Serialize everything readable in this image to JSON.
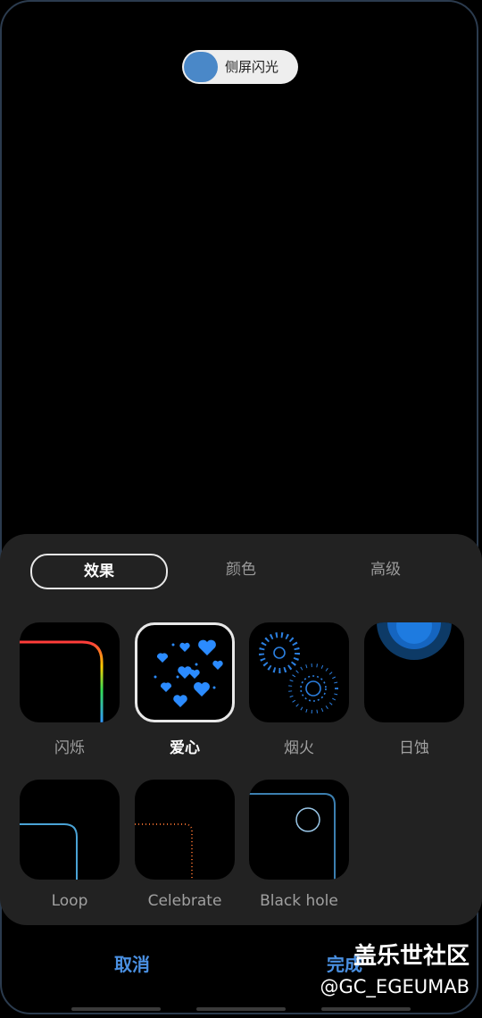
{
  "edge_lighting_toggle": {
    "label": "侧屏闪光"
  },
  "tabs": [
    {
      "label": "效果"
    },
    {
      "label": "颜色"
    },
    {
      "label": "高级"
    }
  ],
  "effects": [
    {
      "label": "闪烁"
    },
    {
      "label": "爱心"
    },
    {
      "label": "烟火"
    },
    {
      "label": "日蚀"
    },
    {
      "label": "Loop"
    },
    {
      "label": "Celebrate"
    },
    {
      "label": "Black hole"
    }
  ],
  "footer": {
    "cancel_label": "取消",
    "done_label": "完成"
  },
  "watermark": {
    "line1": "盖乐世社区",
    "line2": "@GC_EGEUMAB"
  },
  "colors": {
    "accent": "#4a90e2",
    "toggle_knob": "#4a88c8",
    "panel": "#222222"
  }
}
